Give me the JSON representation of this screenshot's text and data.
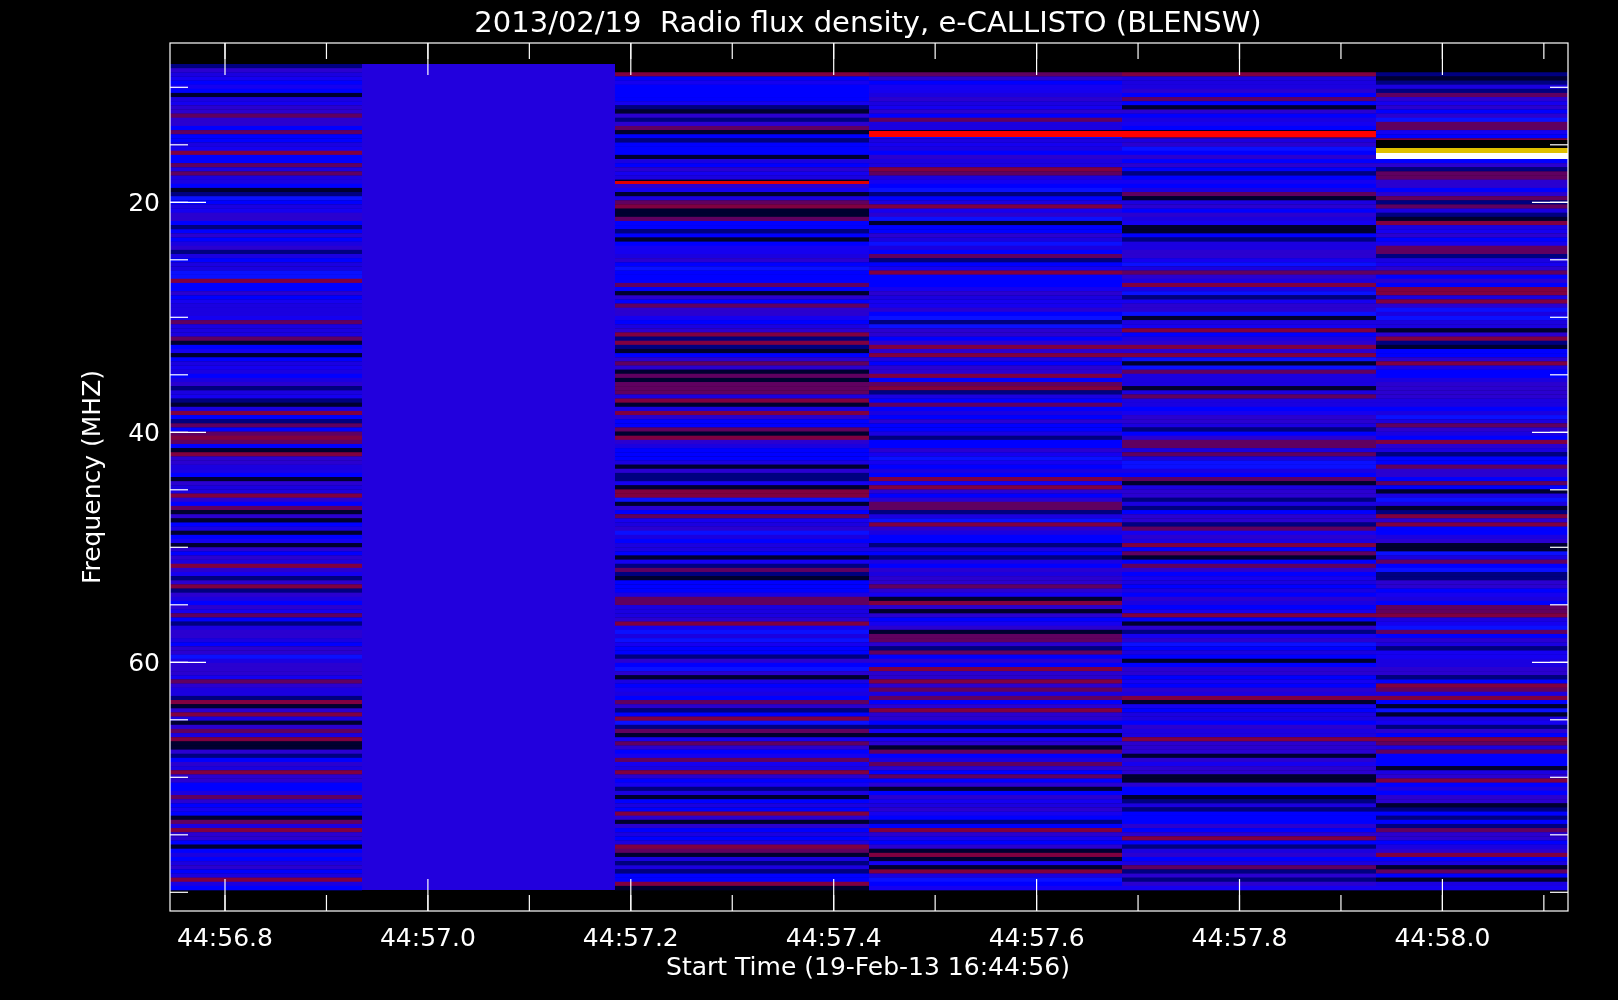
{
  "chart": {
    "title": "2013/02/19  Radio flux density, e-CALLISTO (BLENSW)",
    "ylabel": "Frequency (MHZ)",
    "xlabel": "Start Time (19-Feb-13 16:44:56)",
    "yticks": [
      "20",
      "40",
      "60"
    ],
    "xticks": [
      "44:56.8",
      "44:57.0",
      "44:57.2",
      "44:57.4",
      "44:57.6",
      "44:57.8",
      "44:58.0"
    ]
  }
}
